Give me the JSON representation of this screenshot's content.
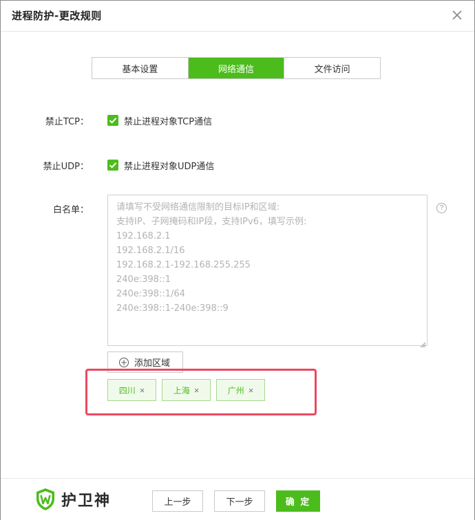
{
  "window": {
    "title": "进程防护-更改规则",
    "close_icon": "close-icon"
  },
  "tabs": [
    {
      "label": "基本设置",
      "active": false
    },
    {
      "label": "网络通信",
      "active": true
    },
    {
      "label": "文件访问",
      "active": false
    }
  ],
  "form": {
    "tcp": {
      "label": "禁止TCP：",
      "checkbox_text": "禁止进程对象TCP通信",
      "checked": true
    },
    "udp": {
      "label": "禁止UDP：",
      "checkbox_text": "禁止进程对象UDP通信",
      "checked": true
    },
    "whitelist": {
      "label": "白名单：",
      "placeholder_lines": [
        "请填写不受网络通信限制的目标IP和区域:",
        "支持IP、子网掩码和IP段，支持IPv6，填写示例:",
        "192.168.2.1",
        "192.168.2.1/16",
        "192.168.2.1-192.168.255.255",
        "240e:398::1",
        "240e:398::1/64",
        "240e:398::1-240e:398::9"
      ],
      "help_icon": "question-circle-icon",
      "help_glyph": "?"
    },
    "add_region_button": "添加区域",
    "add_icon_glyph": "+",
    "regions": [
      {
        "label": "四川",
        "remove": "×"
      },
      {
        "label": "上海",
        "remove": "×"
      },
      {
        "label": "广州",
        "remove": "×"
      }
    ]
  },
  "footer": {
    "brand": "护卫神",
    "prev_button": "上一步",
    "next_button": "下一步",
    "confirm_button": "确 定"
  },
  "colors": {
    "accent": "#4cbc1c",
    "highlight": "#e84a5f",
    "tag_bg": "#f0faea",
    "tag_border": "#a5d98d"
  }
}
